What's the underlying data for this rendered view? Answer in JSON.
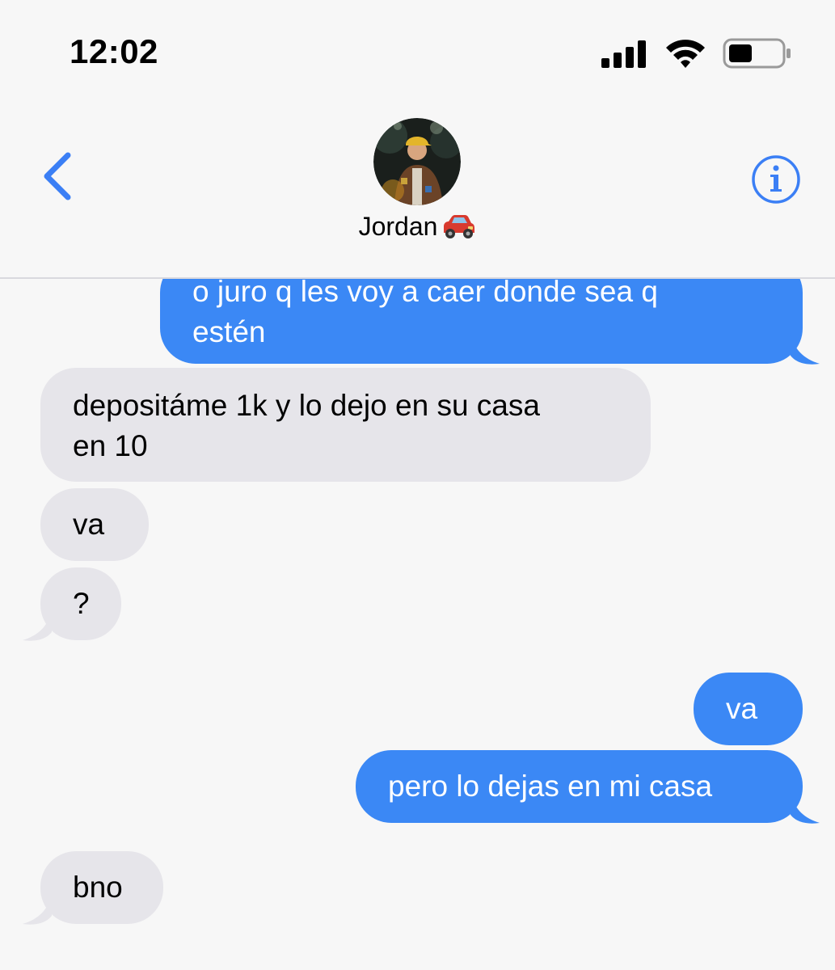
{
  "status_bar": {
    "time": "12:02",
    "icons": [
      "signal-icon",
      "wifi-icon",
      "battery-icon"
    ]
  },
  "header": {
    "back_icon": "chevron-left-icon",
    "contact_name": "Jordan",
    "contact_emoji": "car-icon",
    "info_icon": "info-icon"
  },
  "messages": [
    {
      "direction": "outgoing",
      "text": "o juro q les voy a caer donde sea q\nestén"
    },
    {
      "direction": "incoming",
      "text": "depositáme 1k y lo dejo en su casa\nen 10"
    },
    {
      "direction": "incoming",
      "text": "va"
    },
    {
      "direction": "incoming",
      "text": "?"
    },
    {
      "direction": "outgoing",
      "text": "va"
    },
    {
      "direction": "outgoing",
      "text": "pero lo dejas en mi casa"
    },
    {
      "direction": "incoming",
      "text": "bno"
    }
  ],
  "colors": {
    "outgoing_bubble": "#3b88f5",
    "incoming_bubble": "#e6e5ea",
    "accent": "#3b7ff5",
    "background": "#f7f7f7"
  }
}
